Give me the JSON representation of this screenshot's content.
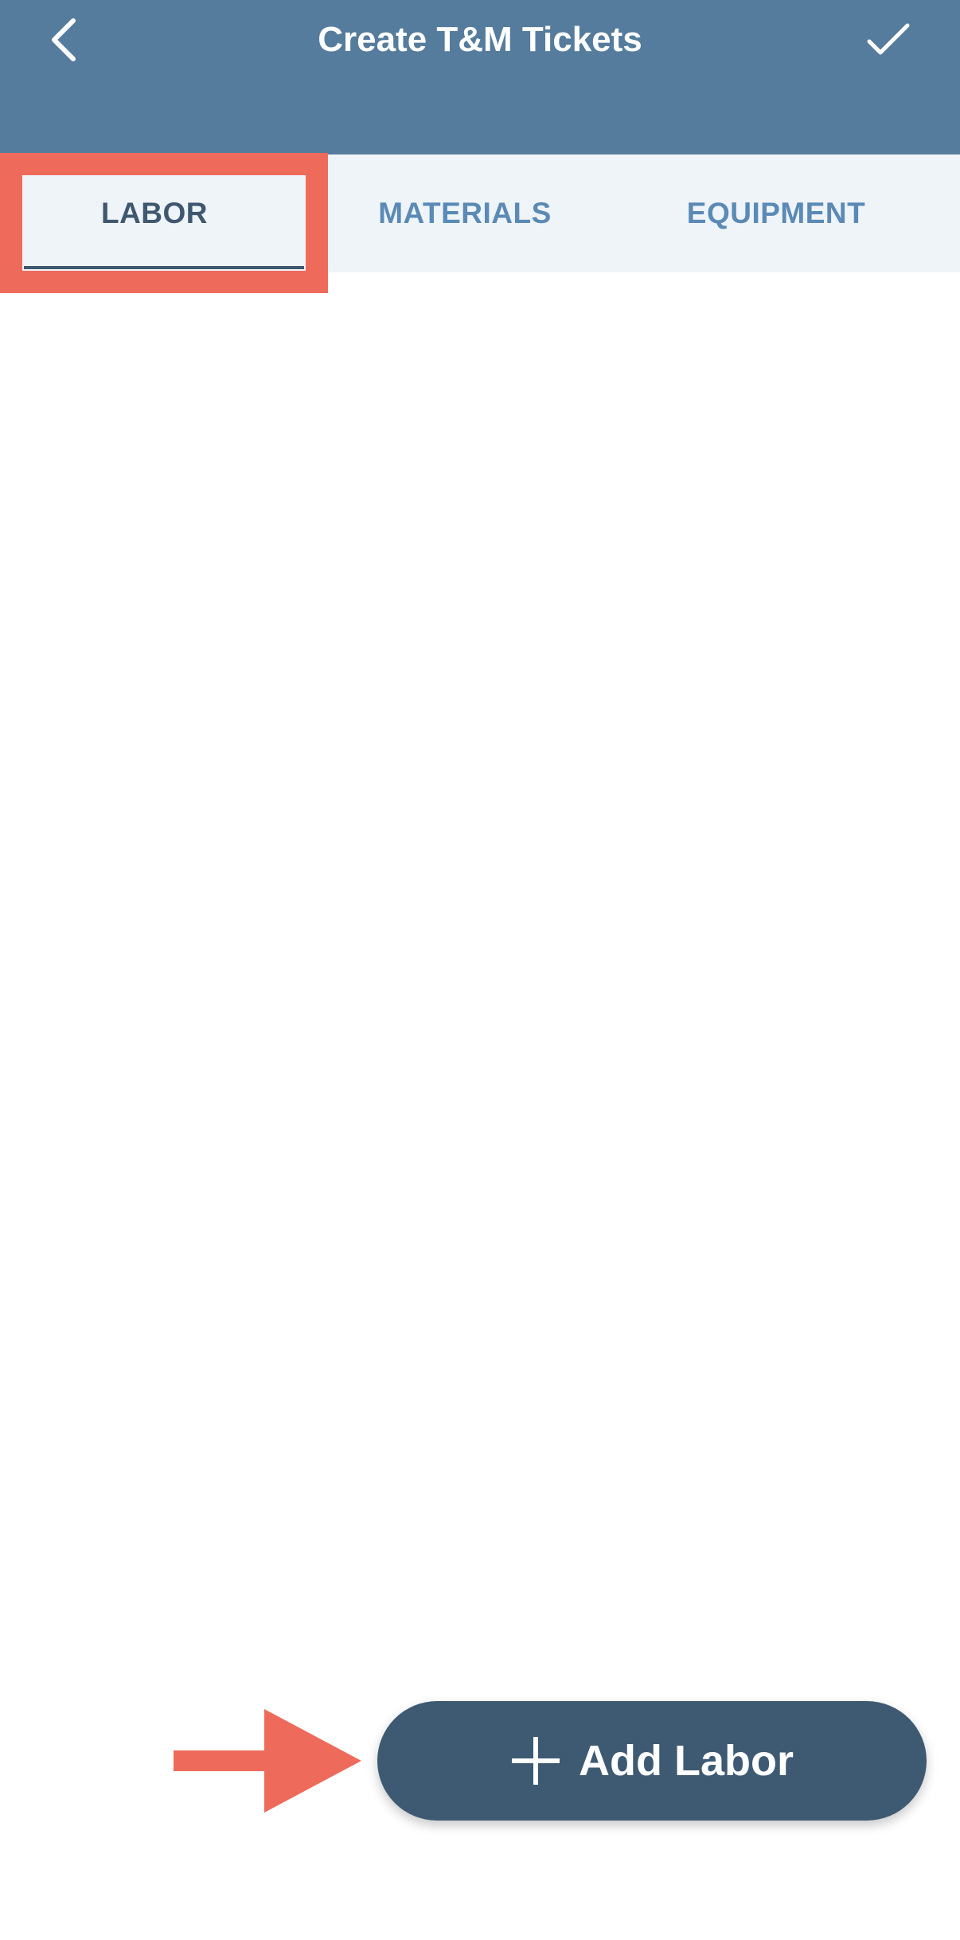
{
  "nav": {
    "title": "Create T&M Tickets",
    "back_icon": "chevron-left-icon",
    "done_icon": "checkmark-icon"
  },
  "tabs": [
    {
      "label": "LABOR",
      "selected": true
    },
    {
      "label": "MATERIALS",
      "selected": false
    },
    {
      "label": "EQUIPMENT",
      "selected": false
    }
  ],
  "fab": {
    "icon": "plus-icon",
    "label": "Add Labor"
  },
  "annotations": {
    "highlight_color": "#ee6b5b",
    "arrow_color": "#ee6b5b"
  },
  "colors": {
    "nav_background": "#557c9d",
    "tab_background": "#eff4f8",
    "tab_selected": "#40586f",
    "tab_unselected": "#5a8ab5",
    "button_background": "#3e5a73"
  }
}
